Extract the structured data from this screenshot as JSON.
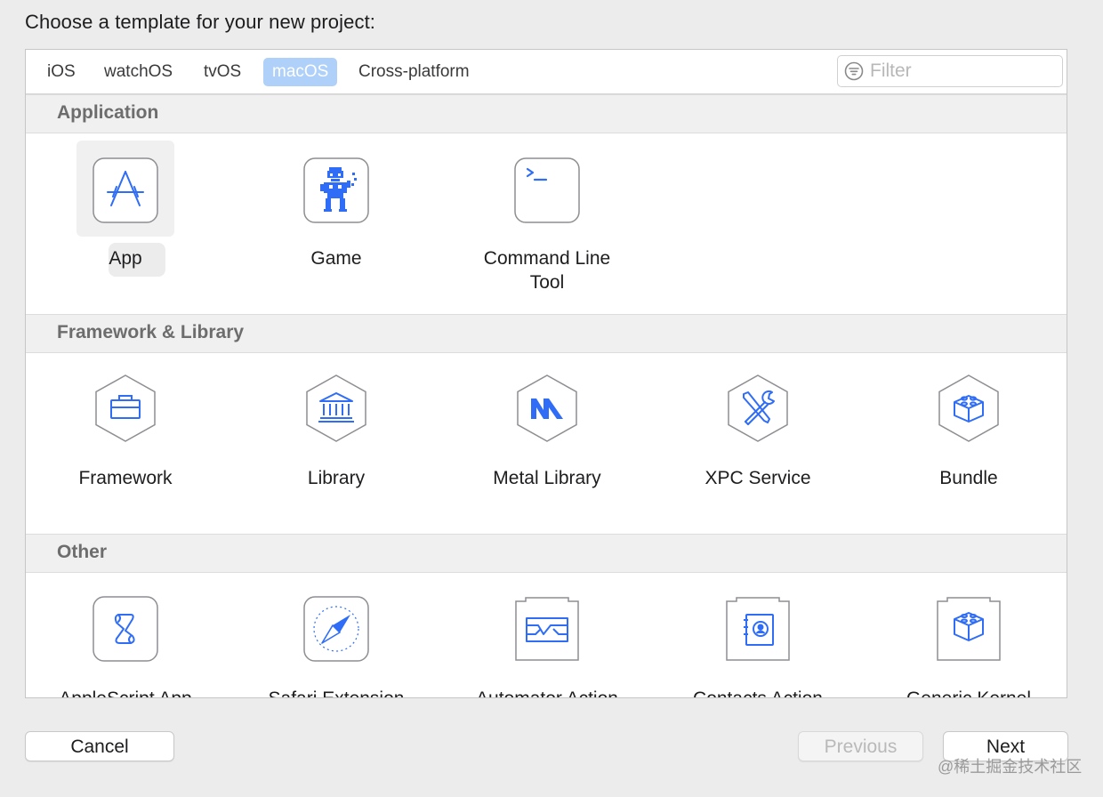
{
  "dialog": {
    "heading": "Choose a template for your new project:"
  },
  "tabs": [
    "iOS",
    "watchOS",
    "tvOS",
    "macOS",
    "Cross-platform"
  ],
  "active_tab": "macOS",
  "filter": {
    "placeholder": "Filter",
    "value": ""
  },
  "sections": {
    "application": {
      "title": "Application",
      "items": [
        {
          "label": "App",
          "icon": "app-store-icon",
          "selected": true
        },
        {
          "label": "Game",
          "icon": "game-character-icon"
        },
        {
          "label_line1": "Command Line",
          "label_line2": "Tool",
          "icon": "terminal-icon"
        }
      ]
    },
    "framework": {
      "title": "Framework & Library",
      "items": [
        {
          "label": "Framework",
          "icon": "toolbox-icon"
        },
        {
          "label": "Library",
          "icon": "library-building-icon"
        },
        {
          "label": "Metal Library",
          "icon": "metal-icon"
        },
        {
          "label": "XPC Service",
          "icon": "tools-icon"
        },
        {
          "label": "Bundle",
          "icon": "lego-block-icon"
        }
      ]
    },
    "other": {
      "title": "Other",
      "items": [
        {
          "label": "AppleScript App",
          "icon": "script-icon"
        },
        {
          "label": "Safari Extension",
          "icon": "compass-icon"
        },
        {
          "label": "Automator Action",
          "icon": "automator-icon"
        },
        {
          "label": "Contacts Action",
          "icon": "contacts-icon"
        },
        {
          "label": "Generic Kernel",
          "icon": "kernel-block-icon"
        }
      ]
    }
  },
  "buttons": {
    "cancel": "Cancel",
    "previous": "Previous",
    "next": "Next"
  },
  "watermark": "@稀土掘金技术社区",
  "colors": {
    "accent": "#2f6df6",
    "active_tab_bg": "#aed0f9",
    "icon_stroke": "#8e8e93",
    "section_bg": "#f0f0f0"
  }
}
